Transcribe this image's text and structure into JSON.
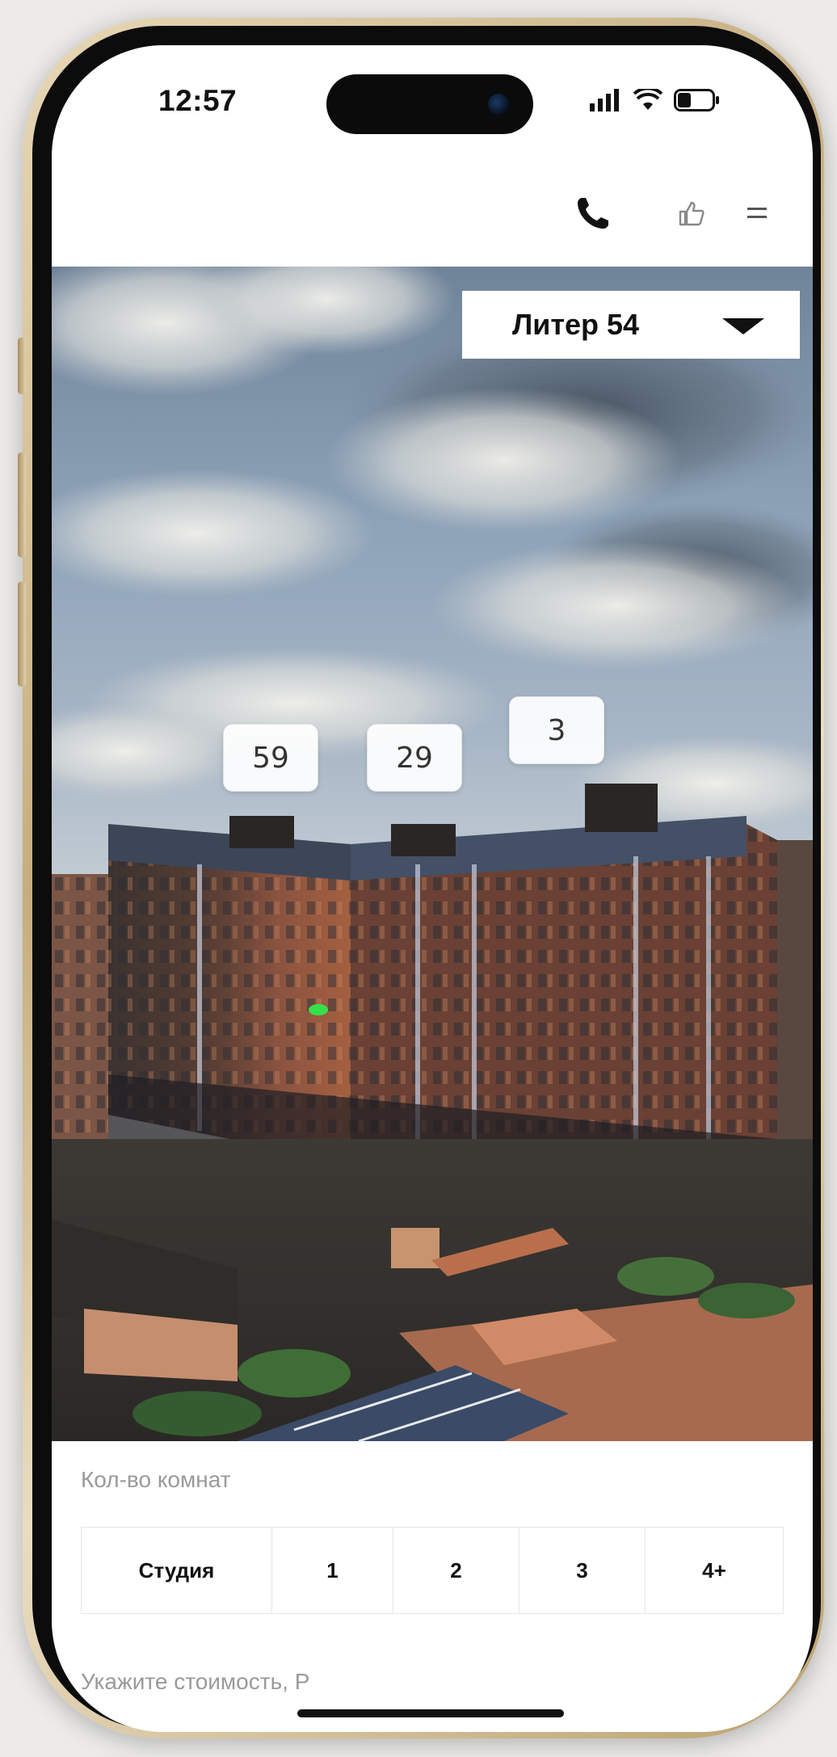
{
  "status_bar": {
    "time": "12:57"
  },
  "header": {
    "icons": [
      "phone-icon",
      "thumbs-up-icon",
      "menu-icon"
    ]
  },
  "building_selector": {
    "value": "Литер 54"
  },
  "section_badges": [
    {
      "label": "59"
    },
    {
      "label": "29"
    },
    {
      "label": "3"
    }
  ],
  "filters": {
    "rooms_label": "Кол-во комнат",
    "room_options": [
      "Студия",
      "1",
      "2",
      "3",
      "4+"
    ],
    "price_label": "Укажите стоимость, Р"
  },
  "colors": {
    "accent": "#111111",
    "muted_text": "#9a9a9a",
    "frame_gold": "#c6ad7f",
    "highlight_marker": "#35e04a"
  }
}
